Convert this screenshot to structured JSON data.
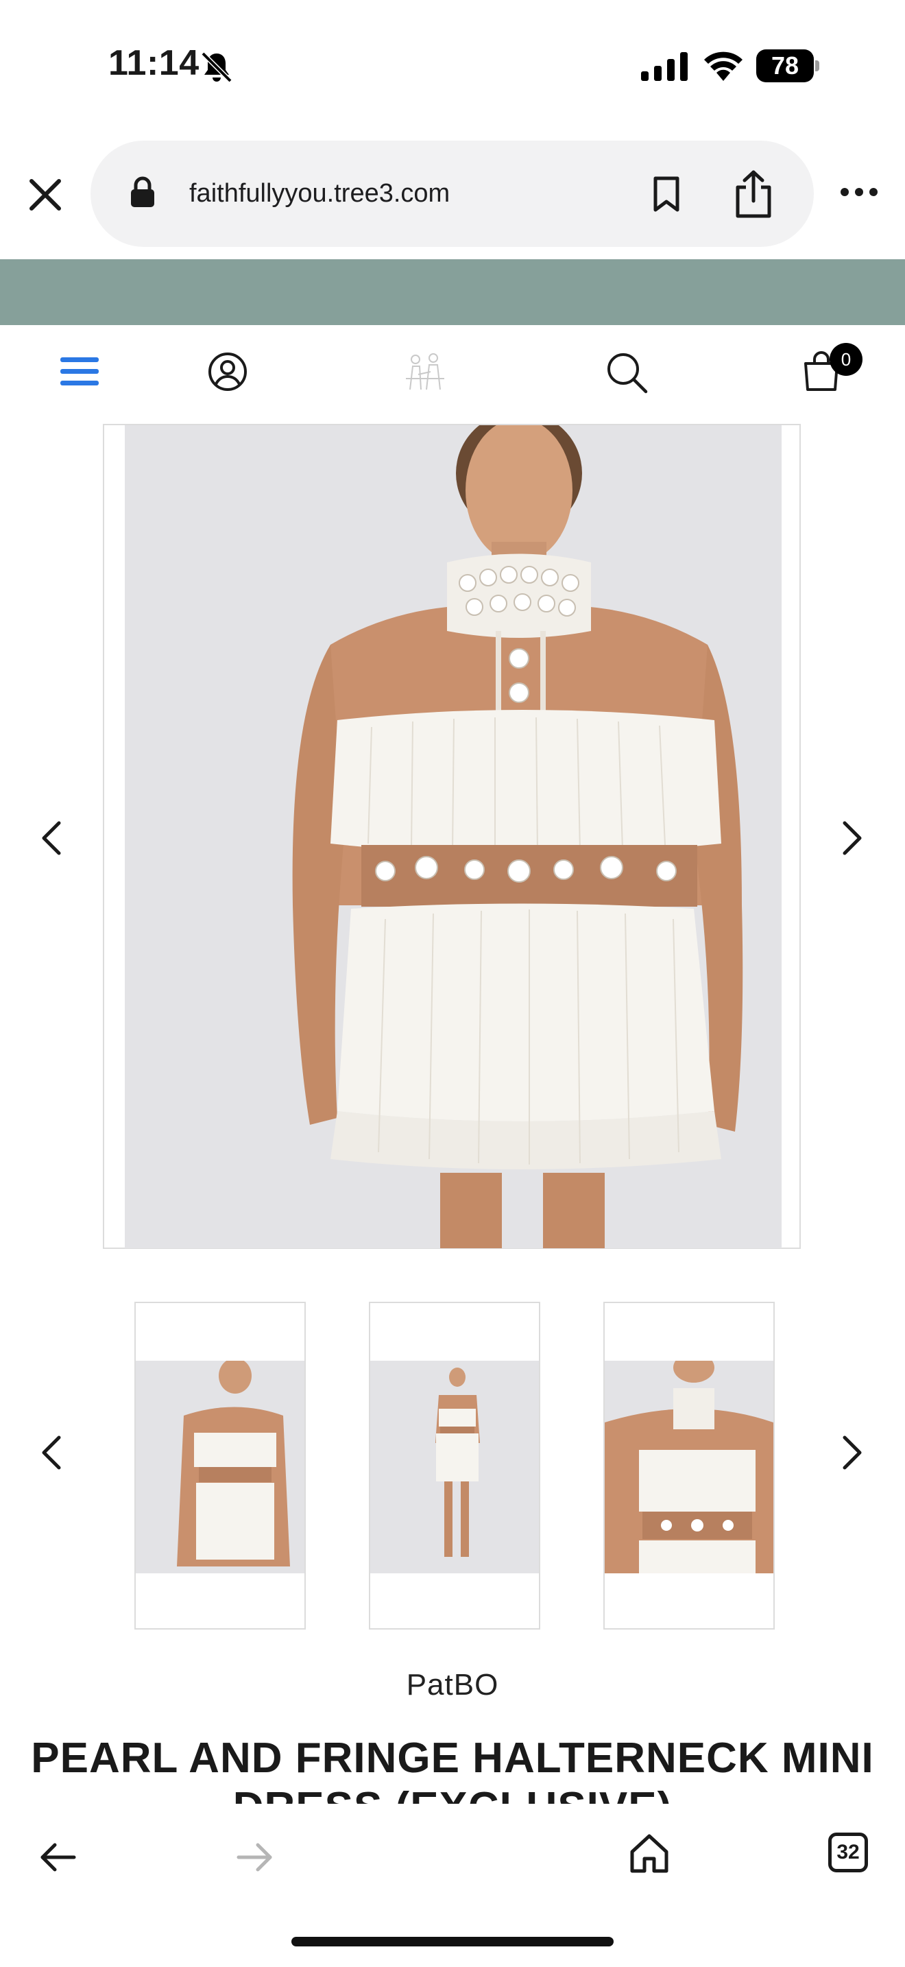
{
  "status_bar": {
    "time": "11:14",
    "battery": "78",
    "icons": [
      "bell-off-icon",
      "signal-icon",
      "wifi-icon",
      "battery-icon"
    ]
  },
  "browser": {
    "url": "faithfullyyou.tree3.com",
    "icons": [
      "close-icon",
      "lock-icon",
      "bookmark-icon",
      "share-icon",
      "more-icon"
    ]
  },
  "header": {
    "icons": [
      "hamburger-menu-icon",
      "account-icon",
      "logo",
      "search-icon",
      "cart-icon"
    ],
    "cart_count": "0"
  },
  "gallery": {
    "main_image": "model in white pearl and fringe halterneck mini dress",
    "thumbnails": [
      "front view close",
      "full length view",
      "detail view"
    ],
    "nav_icons": [
      "chevron-left-icon",
      "chevron-right-icon"
    ]
  },
  "product": {
    "brand": "PatBO",
    "title": "PEARL AND FRINGE HALTERNECK MINI DRESS (EXCLUSIVE)"
  },
  "toolbar": {
    "tab_count": "32",
    "icons": [
      "back-arrow-icon",
      "forward-arrow-icon",
      "home-icon",
      "tabs-icon"
    ]
  },
  "colors": {
    "announcement_bar": "#86a09a",
    "menu_accent": "#2b78e4"
  }
}
